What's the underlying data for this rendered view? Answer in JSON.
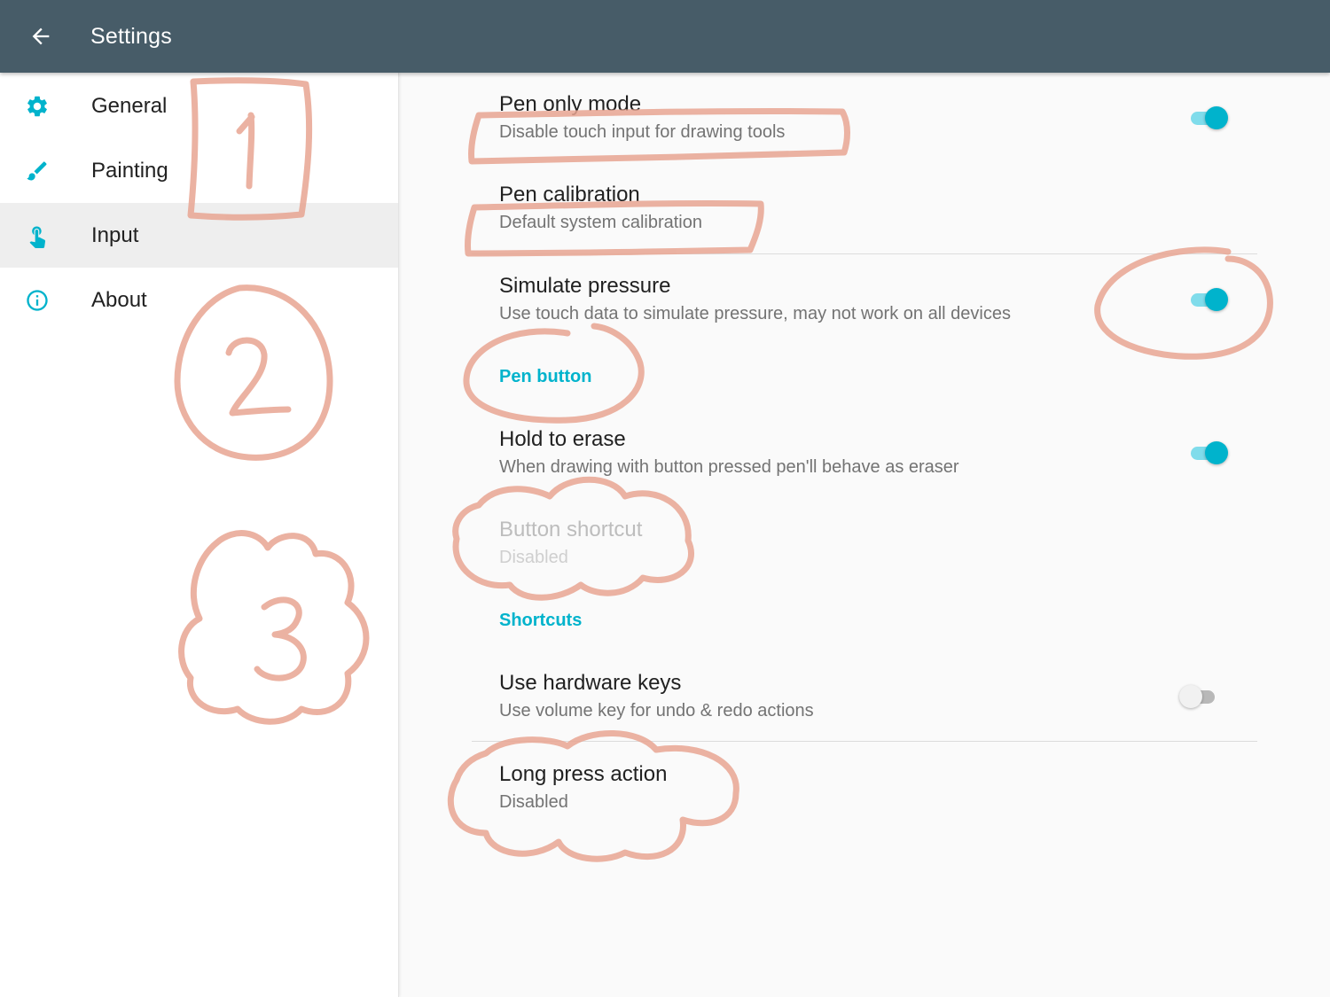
{
  "appbar": {
    "title": "Settings",
    "back_icon": "arrow-back-icon",
    "color": "#475c68"
  },
  "sidebar": {
    "items": [
      {
        "label": "General",
        "icon": "gear-icon",
        "active": false
      },
      {
        "label": "Painting",
        "icon": "brush-icon",
        "active": false
      },
      {
        "label": "Input",
        "icon": "touch-hand-icon",
        "active": true
      },
      {
        "label": "About",
        "icon": "info-icon",
        "active": false
      }
    ]
  },
  "content": {
    "pen_only_mode": {
      "title": "Pen only mode",
      "summary": "Disable touch input for drawing tools",
      "switch_on": true
    },
    "pen_calibration": {
      "title": "Pen calibration",
      "summary": "Default system calibration"
    },
    "simulate_pressure": {
      "title": "Simulate pressure",
      "summary": "Use touch data to simulate pressure, may not work on all devices",
      "switch_on": true
    },
    "pen_button_header": "Pen button",
    "hold_to_erase": {
      "title": "Hold to erase",
      "summary": "When drawing with button pressed pen'll behave as eraser",
      "switch_on": true
    },
    "button_shortcut": {
      "title": "Button shortcut",
      "summary": "Disabled",
      "enabled": false
    },
    "shortcuts_header": "Shortcuts",
    "use_hardware_keys": {
      "title": "Use hardware keys",
      "summary": "Use volume key for undo & redo actions",
      "switch_on": false
    },
    "long_press_action": {
      "title": "Long press action",
      "summary": "Disabled"
    }
  },
  "colors": {
    "accent": "#00b3cc",
    "annotation": "#e8a592"
  }
}
